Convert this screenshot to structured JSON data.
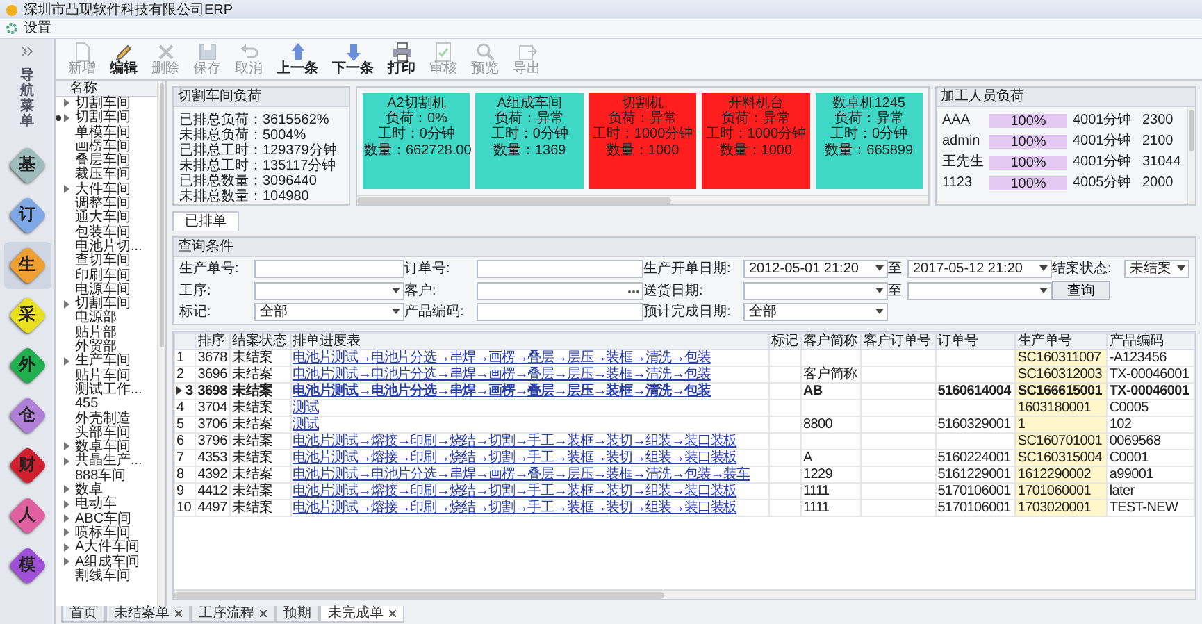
{
  "window": {
    "title": "深圳市凸现软件科技有限公司ERP"
  },
  "menu": [
    {
      "label": "设置"
    }
  ],
  "nav_label": "导航菜单",
  "modules": [
    {
      "label": "基",
      "color": "#9fbcbc",
      "selected": false
    },
    {
      "label": "订",
      "color": "#7fa8e8",
      "selected": false
    },
    {
      "label": "生",
      "color": "#f0a030",
      "selected": true
    },
    {
      "label": "采",
      "color": "#e8e020",
      "selected": false
    },
    {
      "label": "外",
      "color": "#20b050",
      "selected": false
    },
    {
      "label": "仓",
      "color": "#b080d8",
      "selected": false
    },
    {
      "label": "财",
      "color": "#d02030",
      "selected": false
    },
    {
      "label": "人",
      "color": "#e060a0",
      "selected": false
    },
    {
      "label": "模",
      "color": "#a050d8",
      "selected": false
    }
  ],
  "toolbar": [
    {
      "label": "新增",
      "disabled": true
    },
    {
      "label": "编辑",
      "disabled": false
    },
    {
      "label": "删除",
      "disabled": true
    },
    {
      "label": "保存",
      "disabled": true
    },
    {
      "label": "取消",
      "disabled": true
    },
    {
      "label": "上一条",
      "disabled": false
    },
    {
      "label": "下一条",
      "disabled": false
    },
    {
      "label": "打印",
      "disabled": false
    },
    {
      "label": "审核",
      "disabled": true
    },
    {
      "label": "预览",
      "disabled": true
    },
    {
      "label": "导出",
      "disabled": true
    }
  ],
  "tree": {
    "header": "名称",
    "items": [
      {
        "label": "切割车间",
        "kind": "group",
        "selected": false
      },
      {
        "label": "切割车间",
        "kind": "group",
        "selected": true
      },
      {
        "label": "单模车间",
        "kind": "leaf",
        "selected": false
      },
      {
        "label": "画楞车间",
        "kind": "leaf",
        "selected": false
      },
      {
        "label": "叠层车间",
        "kind": "leaf",
        "selected": false
      },
      {
        "label": "裁压车间",
        "kind": "leaf",
        "selected": false
      },
      {
        "label": "大件车间",
        "kind": "group",
        "selected": false
      },
      {
        "label": "调整车间",
        "kind": "leaf",
        "selected": false
      },
      {
        "label": "通大车间",
        "kind": "leaf",
        "selected": false
      },
      {
        "label": "包装车间",
        "kind": "leaf",
        "selected": false
      },
      {
        "label": "电池片切...",
        "kind": "leaf",
        "selected": false
      },
      {
        "label": "查切车间",
        "kind": "leaf",
        "selected": false
      },
      {
        "label": "印刷车间",
        "kind": "leaf",
        "selected": false
      },
      {
        "label": "电源车间",
        "kind": "leaf",
        "selected": false
      },
      {
        "label": "切割车间",
        "kind": "group",
        "selected": false
      },
      {
        "label": "电源部",
        "kind": "leaf",
        "selected": false
      },
      {
        "label": "贴片部",
        "kind": "leaf",
        "selected": false
      },
      {
        "label": "外贸部",
        "kind": "leaf",
        "selected": false
      },
      {
        "label": "生产车间",
        "kind": "group",
        "selected": false
      },
      {
        "label": "贴片车间",
        "kind": "leaf",
        "selected": false
      },
      {
        "label": "测试工作...",
        "kind": "leaf",
        "selected": false
      },
      {
        "label": "455",
        "kind": "leaf",
        "selected": false
      },
      {
        "label": "外壳制造",
        "kind": "leaf",
        "selected": false
      },
      {
        "label": "头部车间",
        "kind": "leaf",
        "selected": false
      },
      {
        "label": "数卓车间",
        "kind": "group",
        "selected": false
      },
      {
        "label": "共晶生产...",
        "kind": "group",
        "selected": false
      },
      {
        "label": "888车间",
        "kind": "leaf",
        "selected": false
      },
      {
        "label": "数卓",
        "kind": "group",
        "selected": false
      },
      {
        "label": "电动车",
        "kind": "group",
        "selected": false
      },
      {
        "label": "ABC车间",
        "kind": "group",
        "selected": false
      },
      {
        "label": "喷标车间",
        "kind": "group",
        "selected": false
      },
      {
        "label": "A大件车间",
        "kind": "group",
        "selected": false
      },
      {
        "label": "A组成车间",
        "kind": "group",
        "selected": false
      },
      {
        "label": "割线车间",
        "kind": "leaf",
        "selected": false
      }
    ]
  },
  "load_panel": {
    "title": "切割车间负荷",
    "stats": [
      "已排总负荷：3615562%",
      "未排总负荷：5004%",
      "已排总工时：129379分钟",
      "未排总工时：135117分钟",
      "已排总数量：3096440",
      "未排总数量：104980"
    ]
  },
  "machines": [
    {
      "name": "A2切割机",
      "color": "#3fd8c6",
      "lines": [
        "负荷：0%",
        "工时：0分钟",
        "数量：662728.00"
      ]
    },
    {
      "name": "A组成车间",
      "color": "#3fd8c6",
      "lines": [
        "负荷：异常",
        "工时：0分钟",
        "数量：1369"
      ]
    },
    {
      "name": "切割机",
      "color": "#ff1e1e",
      "lines": [
        "负荷：异常",
        "工时：1000分钟",
        "数量：1000"
      ]
    },
    {
      "name": "开料机台",
      "color": "#ff1e1e",
      "lines": [
        "负荷：异常",
        "工时：1000分钟",
        "数量：1000"
      ]
    },
    {
      "name": "数卓机1245",
      "color": "#3fd8c6",
      "lines": [
        "负荷：异常",
        "工时：0分钟",
        "数量：665899"
      ]
    }
  ],
  "worker_panel": {
    "title": "加工人员负荷",
    "rows": [
      {
        "name": "AAA",
        "level": 1,
        "percent": "100%",
        "time": "4001分钟",
        "qty": "2300"
      },
      {
        "name": "admin",
        "level": 1,
        "percent": "100%",
        "time": "4001分钟",
        "qty": "2100"
      },
      {
        "name": "王先生",
        "level": 1,
        "percent": "100%",
        "time": "4001分钟",
        "qty": "31044"
      },
      {
        "name": "1123",
        "level": 1,
        "percent": "100%",
        "time": "4005分钟",
        "qty": "2000"
      }
    ]
  },
  "tabs": [
    {
      "label": "已排单",
      "selected": true
    }
  ],
  "query": {
    "title": "查询条件",
    "rows": [
      [
        {
          "kind": "label",
          "text": "生产单号:"
        },
        {
          "kind": "input"
        },
        {
          "kind": "label",
          "text": "订单号:"
        },
        {
          "kind": "input"
        },
        {
          "kind": "label",
          "text": "生产开单日期:"
        },
        {
          "kind": "select",
          "value": "2012-05-01 21:20"
        },
        {
          "kind": "label",
          "text": "至"
        },
        {
          "kind": "select",
          "value": "2017-05-12 21:20"
        },
        {
          "kind": "label",
          "text": "结案状态:"
        },
        {
          "kind": "select",
          "value": "未结案"
        }
      ],
      [
        {
          "kind": "label",
          "text": "工序:"
        },
        {
          "kind": "select"
        },
        {
          "kind": "label",
          "text": "客户:"
        },
        {
          "kind": "lookup"
        },
        {
          "kind": "label",
          "text": "送货日期:"
        },
        {
          "kind": "select"
        },
        {
          "kind": "label",
          "text": "至"
        },
        {
          "kind": "select"
        },
        {
          "kind": "button",
          "text": "查询"
        }
      ],
      [
        {
          "kind": "label",
          "text": "标记:"
        },
        {
          "kind": "select",
          "value": "全部"
        },
        {
          "kind": "label",
          "text": "产品编码:"
        },
        {
          "kind": "input"
        },
        {
          "kind": "label",
          "text": "预计完成日期:"
        },
        {
          "kind": "select",
          "value": "全部"
        }
      ]
    ]
  },
  "table": {
    "columns": [
      {
        "label": "排序",
        "kind": "text"
      },
      {
        "label": "结案状态",
        "kind": "text"
      },
      {
        "label": "排单进度表",
        "kind": "link"
      },
      {
        "label": "标记",
        "kind": "text"
      },
      {
        "label": "客户简称",
        "kind": "text"
      },
      {
        "label": "客户订单号",
        "kind": "text"
      },
      {
        "label": "订单号",
        "kind": "text"
      },
      {
        "label": "生产单号",
        "kind": "key"
      },
      {
        "label": "产品编码",
        "kind": "text"
      }
    ],
    "rows": [
      {
        "number": "1",
        "selected": false,
        "cells": [
          "3678",
          "未结案",
          "电池片测试→电池片分选→串焊→画楞→叠层→层压→装框→清洗→包装",
          null,
          null,
          null,
          null,
          "SC160311007",
          "-A123456"
        ]
      },
      {
        "number": "2",
        "selected": false,
        "cells": [
          "3696",
          "未结案",
          "电池片测试→电池片分选→串焊→画楞→叠层→层压→装框→清洗→包装",
          null,
          "客户简称",
          null,
          null,
          "SC160312003",
          "TX-00046001"
        ]
      },
      {
        "number": "3",
        "selected": true,
        "cells": [
          "3698",
          "未结案",
          "电池片测试→电池片分选→串焊→画楞→叠层→层压→装框→清洗→包装",
          null,
          "AB",
          null,
          "5160614004",
          "SC166615001",
          "TX-00046001"
        ]
      },
      {
        "number": "4",
        "selected": false,
        "cells": [
          "3704",
          "未结案",
          "测试",
          null,
          null,
          null,
          null,
          "1603180001",
          "C0005"
        ]
      },
      {
        "number": "5",
        "selected": false,
        "cells": [
          "3706",
          "未结案",
          "测试",
          null,
          "8800",
          null,
          "5160329001",
          "1",
          "102"
        ]
      },
      {
        "number": "6",
        "selected": false,
        "cells": [
          "3796",
          "未结案",
          "电池片测试→熔接→印刷→烧结→切割→手工→装框→装切→组装→装口装板",
          null,
          null,
          null,
          null,
          "SC160701001",
          "0069568"
        ]
      },
      {
        "number": "7",
        "selected": false,
        "cells": [
          "4353",
          "未结案",
          "电池片测试→熔接→印刷→烧结→切割→手工→装框→装切→组装→装口装板",
          null,
          "A",
          null,
          "5160224001",
          "SC160315004",
          "C0001"
        ]
      },
      {
        "number": "8",
        "selected": false,
        "cells": [
          "4392",
          "未结案",
          "电池片测试→电池片分选→串焊→画楞→叠层→层压→装框→清洗→包装→装车",
          null,
          "1229",
          null,
          "5161229001",
          "1612290002",
          "a99001"
        ]
      },
      {
        "number": "9",
        "selected": false,
        "cells": [
          "4412",
          "未结案",
          "电池片测试→熔接→印刷→烧结→切割→手工→装框→装切→组装→装口装板",
          null,
          "1111",
          null,
          "5170106001",
          "1701060001",
          "later"
        ]
      },
      {
        "number": "10",
        "selected": false,
        "cells": [
          "4497",
          "未结案",
          "电池片测试→熔接→印刷→烧结→切割→手工→装框→装切→组装→装口装板",
          null,
          "1111",
          null,
          "5170106001",
          "1703020001",
          "TEST-NEW"
        ]
      }
    ]
  },
  "doc_tabs": [
    {
      "label": "首页",
      "closable": false,
      "selected": false
    },
    {
      "label": "未结案单",
      "closable": true,
      "selected": false
    },
    {
      "label": "工序流程",
      "closable": true,
      "selected": false
    },
    {
      "label": "预期",
      "closable": false,
      "selected": false
    },
    {
      "label": "未完成单",
      "closable": true,
      "selected": true
    }
  ]
}
